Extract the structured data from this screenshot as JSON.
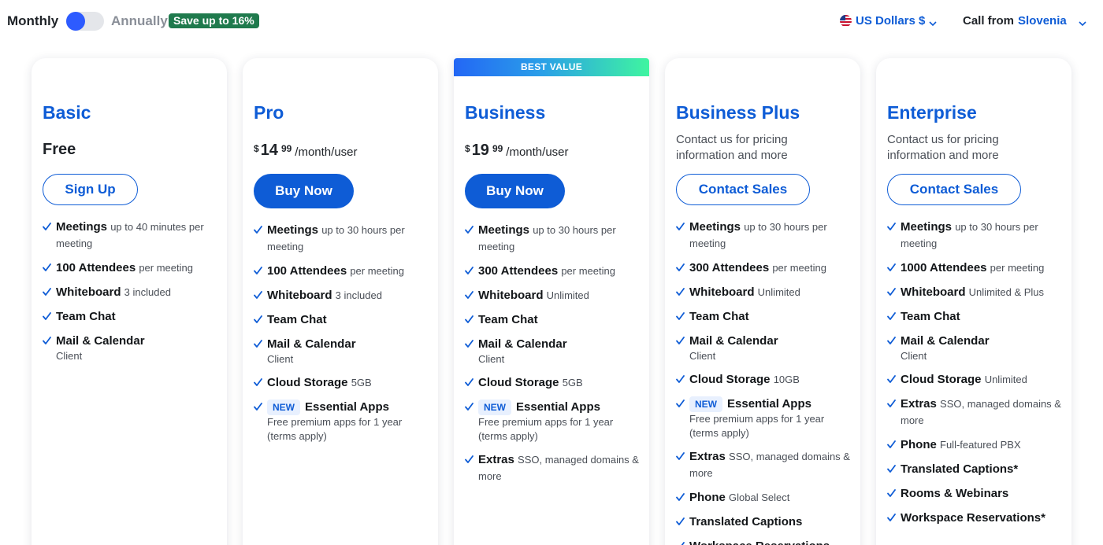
{
  "billing": {
    "monthly_label": "Monthly",
    "annual_label": "Annually",
    "save_badge": "Save up to 16%",
    "selected": "Monthly"
  },
  "currency": {
    "label": "US Dollars $"
  },
  "call_from": {
    "prefix": "Call from",
    "country": "Slovenia"
  },
  "colors": {
    "brand_blue": "#0e5cd6",
    "toggle_knob": "#2d5bff",
    "save_green": "#1f7a4d"
  },
  "plans": [
    {
      "name": "Basic",
      "price_text": "Free",
      "button": "Sign Up",
      "features": [
        {
          "title": "Meetings",
          "detail": "up to 40 minutes per meeting"
        },
        {
          "title": "100 Attendees",
          "detail": "per meeting"
        },
        {
          "title": "Whiteboard",
          "detail": "3 included"
        },
        {
          "title": "Team Chat",
          "detail": ""
        },
        {
          "title": "Mail & Calendar",
          "detail": "Client"
        }
      ]
    },
    {
      "name": "Pro",
      "price": {
        "currency": "$",
        "amount": "14",
        "cents": "99",
        "per": "/month/user"
      },
      "button": "Buy Now",
      "features": [
        {
          "title": "Meetings",
          "detail": "up to 30 hours per meeting"
        },
        {
          "title": "100 Attendees",
          "detail": "per meeting"
        },
        {
          "title": "Whiteboard",
          "detail": "3 included"
        },
        {
          "title": "Team Chat",
          "detail": ""
        },
        {
          "title": "Mail & Calendar",
          "detail": "Client"
        },
        {
          "title": "Cloud Storage",
          "detail": "5GB"
        },
        {
          "tag": "NEW",
          "title": "Essential Apps",
          "detail": "Free premium apps for 1 year (terms apply)"
        }
      ]
    },
    {
      "name": "Business",
      "banner": "BEST VALUE",
      "price": {
        "currency": "$",
        "amount": "19",
        "cents": "99",
        "per": "/month/user"
      },
      "button": "Buy Now",
      "features": [
        {
          "title": "Meetings",
          "detail": "up to 30 hours per meeting"
        },
        {
          "title": "300 Attendees",
          "detail": "per meeting"
        },
        {
          "title": "Whiteboard",
          "detail": "Unlimited"
        },
        {
          "title": "Team Chat",
          "detail": ""
        },
        {
          "title": "Mail & Calendar",
          "detail": "Client"
        },
        {
          "title": "Cloud Storage",
          "detail": "5GB"
        },
        {
          "tag": "NEW",
          "title": "Essential Apps",
          "detail": "Free premium apps for 1 year (terms apply)"
        },
        {
          "title": "Extras",
          "detail": "SSO, managed domains & more"
        }
      ]
    },
    {
      "name": "Business Plus",
      "contact_text": "Contact us for pricing information and more",
      "button": "Contact Sales",
      "features": [
        {
          "title": "Meetings",
          "detail": "up to 30 hours per meeting"
        },
        {
          "title": "300 Attendees",
          "detail": "per meeting"
        },
        {
          "title": "Whiteboard",
          "detail": "Unlimited"
        },
        {
          "title": "Team Chat",
          "detail": ""
        },
        {
          "title": "Mail & Calendar",
          "detail": "Client"
        },
        {
          "title": "Cloud Storage",
          "detail": "10GB"
        },
        {
          "tag": "NEW",
          "title": "Essential Apps",
          "detail": "Free premium apps for 1 year (terms apply)"
        },
        {
          "title": "Extras",
          "detail": "SSO, managed domains & more"
        },
        {
          "title": "Phone",
          "detail": "Global Select"
        },
        {
          "title": "Translated Captions",
          "detail": ""
        },
        {
          "title": "Workspace Reservations",
          "detail": ""
        }
      ]
    },
    {
      "name": "Enterprise",
      "contact_text": "Contact us for pricing information and more",
      "button": "Contact Sales",
      "features": [
        {
          "title": "Meetings",
          "detail": "up to 30 hours per meeting"
        },
        {
          "title": "1000 Attendees",
          "detail": "per meeting"
        },
        {
          "title": "Whiteboard",
          "detail": "Unlimited & Plus"
        },
        {
          "title": "Team Chat",
          "detail": ""
        },
        {
          "title": "Mail & Calendar",
          "detail": "Client"
        },
        {
          "title": "Cloud Storage",
          "detail": "Unlimited"
        },
        {
          "title": "Extras",
          "detail": "SSO, managed domains & more"
        },
        {
          "title": "Phone",
          "detail": "Full-featured PBX"
        },
        {
          "title": "Translated Captions*",
          "detail": ""
        },
        {
          "title": "Rooms & Webinars",
          "detail": ""
        },
        {
          "title": "Workspace Reservations*",
          "detail": ""
        }
      ]
    }
  ]
}
